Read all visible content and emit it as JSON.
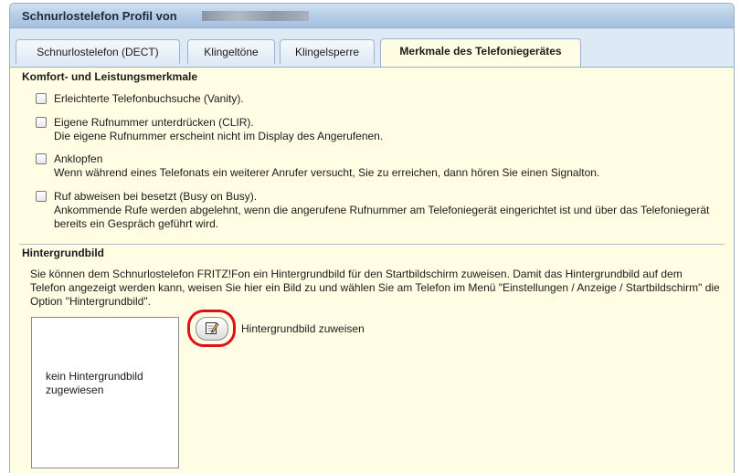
{
  "header": {
    "title": "Schnurlostelefon Profil von"
  },
  "tabs": [
    {
      "label": "Schnurlostelefon (DECT)",
      "active": false
    },
    {
      "label": "Klingeltöne",
      "active": false
    },
    {
      "label": "Klingelsperre",
      "active": false
    },
    {
      "label": "Merkmale des Telefoniegerätes",
      "active": true
    }
  ],
  "comfort": {
    "title": "Komfort- und Leistungsmerkmale",
    "features": [
      {
        "label": "Erleichterte Telefonbuchsuche (Vanity).",
        "description": "",
        "checked": false
      },
      {
        "label": "Eigene Rufnummer unterdrücken (CLIR).",
        "description": "Die eigene Rufnummer erscheint nicht im Display des Angerufenen.",
        "checked": false
      },
      {
        "label": "Anklopfen",
        "description": "Wenn während eines Telefonats ein weiterer Anrufer versucht, Sie zu erreichen, dann hören Sie einen Signalton.",
        "checked": false
      },
      {
        "label": "Ruf abweisen bei besetzt (Busy on Busy).",
        "description": "Ankommende Rufe werden abgelehnt, wenn die angerufene Rufnummer am Telefoniegerät eingerichtet ist und über das Telefoniegerät bereits ein Gespräch geführt wird.",
        "checked": false
      }
    ]
  },
  "wallpaper": {
    "title": "Hintergrundbild",
    "description": "Sie können dem Schnurlostelefon FRITZ!Fon ein Hintergrundbild für den Startbildschirm zuweisen. Damit das Hintergrundbild auf dem Telefon angezeigt werden kann, weisen Sie hier ein Bild zu und wählen Sie am Telefon im Menü \"Einstellungen / Anzeige / Startbildschirm\" die Option \"Hintergrundbild\".",
    "preview_text": "kein Hintergrundbild zugewiesen",
    "assign_label": "Hintergrundbild zuweisen",
    "assign_icon": "edit-icon"
  },
  "colors": {
    "panel_background": "#fffee4",
    "header_blue": "#b3cbe4",
    "highlight_red": "#e0101a"
  }
}
